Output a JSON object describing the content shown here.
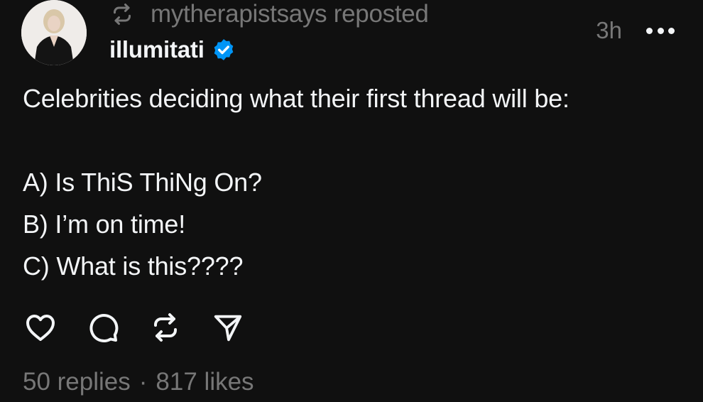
{
  "post": {
    "repost_by": "mytherapistsays reposted",
    "author": "illumitati",
    "timestamp": "3h",
    "text_lines": [
      "Celebrities deciding what their first thread will be:",
      "A) Is ThiS ThiNg On?",
      "B) I’m on time!",
      "C) What is this????"
    ],
    "replies": "50 replies",
    "separator": "·",
    "likes": "817 likes"
  },
  "colors": {
    "background": "#101010",
    "text_primary": "#f3f5f7",
    "text_secondary": "#777777",
    "verified_blue": "#0095f6"
  },
  "icons": {
    "repost_indicator": "repost-icon",
    "verified": "verified-badge-icon",
    "more": "more-horizontal-icon",
    "like": "heart-icon",
    "reply": "comment-bubble-icon",
    "repost": "repost-icon",
    "share": "send-icon"
  }
}
